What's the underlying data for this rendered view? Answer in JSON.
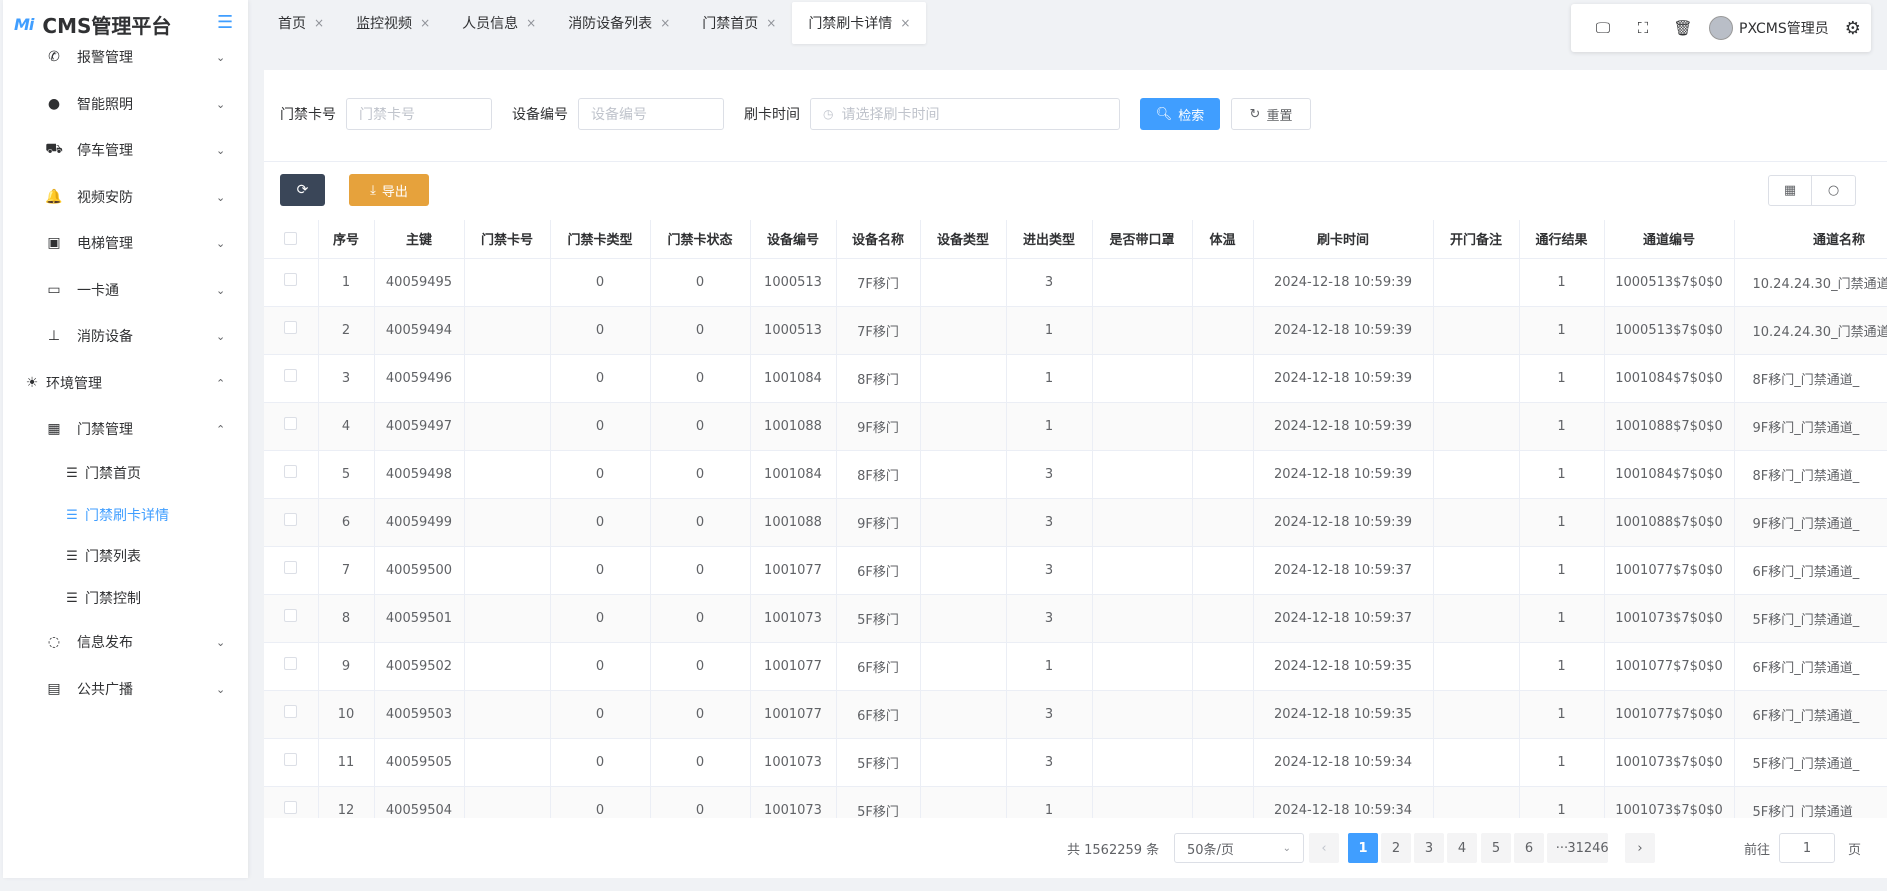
{
  "app": {
    "logo_mark": "Mi",
    "title": "CMS管理平台"
  },
  "sidebar": {
    "items": [
      {
        "label": "报警管理",
        "icon": "phone-alert-icon",
        "glyph": "✆",
        "arrow": "⌄"
      },
      {
        "label": "智能照明",
        "icon": "bulb-icon",
        "glyph": "●",
        "arrow": "⌄"
      },
      {
        "label": "停车管理",
        "icon": "truck-icon",
        "glyph": "⛟",
        "arrow": "⌄"
      },
      {
        "label": "视频安防",
        "icon": "bell-icon",
        "glyph": "🔔",
        "arrow": "⌄"
      },
      {
        "label": "电梯管理",
        "icon": "chip-icon",
        "glyph": "▣",
        "arrow": "⌄"
      },
      {
        "label": "一卡通",
        "icon": "card-icon",
        "glyph": "▭",
        "arrow": "⌄"
      },
      {
        "label": "消防设备",
        "icon": "extinguisher-icon",
        "glyph": "⊥",
        "arrow": "⌄"
      },
      {
        "label": "环境管理",
        "icon": "sun-icon",
        "glyph": "☀",
        "arrow": "⌃"
      },
      {
        "label": "门禁管理",
        "icon": "building-icon",
        "glyph": "▦",
        "arrow": "⌃"
      },
      {
        "label": "门禁首页",
        "icon": "list-icon",
        "glyph": "☰"
      },
      {
        "label": "门禁刷卡详情",
        "icon": "list-icon",
        "glyph": "☰"
      },
      {
        "label": "门禁列表",
        "icon": "list-icon",
        "glyph": "☰"
      },
      {
        "label": "门禁控制",
        "icon": "list-icon",
        "glyph": "☰"
      },
      {
        "label": "信息发布",
        "icon": "chat-icon",
        "glyph": "◌",
        "arrow": "⌄"
      },
      {
        "label": "公共广播",
        "icon": "grid-icon",
        "glyph": "▤",
        "arrow": "⌄"
      }
    ]
  },
  "tabs": [
    {
      "label": "首页",
      "close": "×"
    },
    {
      "label": "监控视频",
      "close": "×"
    },
    {
      "label": "人员信息",
      "close": "×"
    },
    {
      "label": "消防设备列表",
      "close": "×"
    },
    {
      "label": "门禁首页",
      "close": "×"
    },
    {
      "label": "门禁刷卡详情",
      "close": "×"
    }
  ],
  "header": {
    "user": "PXCMS管理员",
    "icons": [
      "monitor-icon",
      "fullscreen-icon",
      "trash-icon",
      "avatar",
      "settings-icon"
    ]
  },
  "search": {
    "card_label": "门禁卡号",
    "card_placeholder": "门禁卡号",
    "device_label": "设备编号",
    "device_placeholder": "设备编号",
    "time_label": "刷卡时间",
    "time_placeholder": "请选择刷卡时间",
    "search_btn": "检索",
    "reset_btn": "重置"
  },
  "toolbar": {
    "export_btn": "导出"
  },
  "table": {
    "columns": [
      "序号",
      "主键",
      "门禁卡号",
      "门禁卡类型",
      "门禁卡状态",
      "设备编号",
      "设备名称",
      "设备类型",
      "进出类型",
      "是否带口罩",
      "体温",
      "刷卡时间",
      "开门备注",
      "通行结果",
      "通道编号",
      "通道名称"
    ],
    "rows": [
      [
        "1",
        "40059495",
        "",
        "0",
        "0",
        "1000513",
        "7F移门",
        "",
        "3",
        "",
        "",
        "2024-12-18 10:59:39",
        "",
        "1",
        "1000513$7$0$0",
        "10.24.24.30_门禁通道"
      ],
      [
        "2",
        "40059494",
        "",
        "0",
        "0",
        "1000513",
        "7F移门",
        "",
        "1",
        "",
        "",
        "2024-12-18 10:59:39",
        "",
        "1",
        "1000513$7$0$0",
        "10.24.24.30_门禁通道"
      ],
      [
        "3",
        "40059496",
        "",
        "0",
        "0",
        "1001084",
        "8F移门",
        "",
        "1",
        "",
        "",
        "2024-12-18 10:59:39",
        "",
        "1",
        "1001084$7$0$0",
        "8F移门_门禁通道_"
      ],
      [
        "4",
        "40059497",
        "",
        "0",
        "0",
        "1001088",
        "9F移门",
        "",
        "1",
        "",
        "",
        "2024-12-18 10:59:39",
        "",
        "1",
        "1001088$7$0$0",
        "9F移门_门禁通道_"
      ],
      [
        "5",
        "40059498",
        "",
        "0",
        "0",
        "1001084",
        "8F移门",
        "",
        "3",
        "",
        "",
        "2024-12-18 10:59:39",
        "",
        "1",
        "1001084$7$0$0",
        "8F移门_门禁通道_"
      ],
      [
        "6",
        "40059499",
        "",
        "0",
        "0",
        "1001088",
        "9F移门",
        "",
        "3",
        "",
        "",
        "2024-12-18 10:59:39",
        "",
        "1",
        "1001088$7$0$0",
        "9F移门_门禁通道_"
      ],
      [
        "7",
        "40059500",
        "",
        "0",
        "0",
        "1001077",
        "6F移门",
        "",
        "3",
        "",
        "",
        "2024-12-18 10:59:37",
        "",
        "1",
        "1001077$7$0$0",
        "6F移门_门禁通道_"
      ],
      [
        "8",
        "40059501",
        "",
        "0",
        "0",
        "1001073",
        "5F移门",
        "",
        "3",
        "",
        "",
        "2024-12-18 10:59:37",
        "",
        "1",
        "1001073$7$0$0",
        "5F移门_门禁通道_"
      ],
      [
        "9",
        "40059502",
        "",
        "0",
        "0",
        "1001077",
        "6F移门",
        "",
        "1",
        "",
        "",
        "2024-12-18 10:59:35",
        "",
        "1",
        "1001077$7$0$0",
        "6F移门_门禁通道_"
      ],
      [
        "10",
        "40059503",
        "",
        "0",
        "0",
        "1001077",
        "6F移门",
        "",
        "3",
        "",
        "",
        "2024-12-18 10:59:35",
        "",
        "1",
        "1001077$7$0$0",
        "6F移门_门禁通道_"
      ],
      [
        "11",
        "40059505",
        "",
        "0",
        "0",
        "1001073",
        "5F移门",
        "",
        "3",
        "",
        "",
        "2024-12-18 10:59:34",
        "",
        "1",
        "1001073$7$0$0",
        "5F移门_门禁通道_"
      ],
      [
        "12",
        "40059504",
        "",
        "0",
        "0",
        "1001073",
        "5F移门",
        "",
        "1",
        "",
        "",
        "2024-12-18 10:59:34",
        "",
        "1",
        "1001073$7$0$0",
        "5F移门_门禁通道_"
      ]
    ]
  },
  "pagination": {
    "total": "共 1562259 条",
    "page_size": "50条/页",
    "prev": "‹",
    "next": "›",
    "pages": [
      "1",
      "2",
      "3",
      "4",
      "5",
      "6",
      "···",
      "31246"
    ],
    "current": "1",
    "goto_label": "前往",
    "goto_value": "1",
    "page_suffix": "页"
  },
  "colors": {
    "primary": "#409eff",
    "warning": "#e6a23c",
    "dark": "#3a4658"
  }
}
